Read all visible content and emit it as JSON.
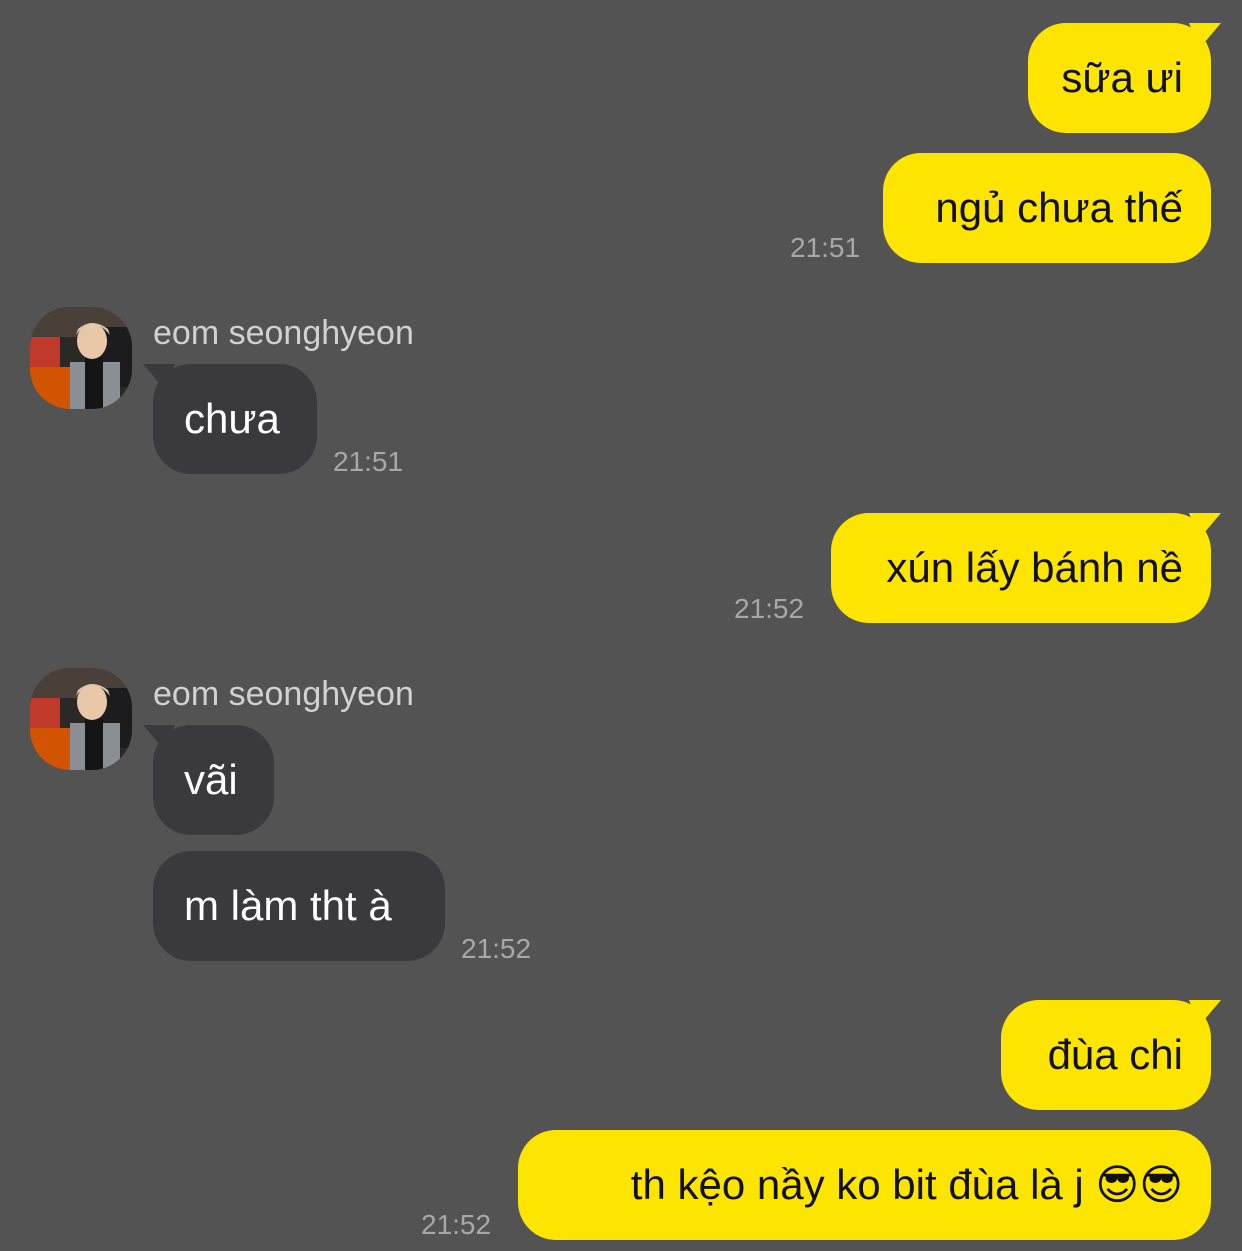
{
  "colors": {
    "background": "#545354",
    "sent_bubble": "#FEE500",
    "received_bubble": "#3A3A3C",
    "timestamp": "#A9A8A9"
  },
  "conversation": {
    "contact_name": "eom seonghyeon",
    "messages": [
      {
        "direction": "sent",
        "text": "sữa ưi"
      },
      {
        "direction": "sent",
        "text": "ngủ chưa thế",
        "time": "21:51"
      },
      {
        "direction": "received",
        "sender": "eom seonghyeon",
        "text": "chưa",
        "time": "21:51"
      },
      {
        "direction": "sent",
        "text": "xún lấy bánh nề",
        "time": "21:52"
      },
      {
        "direction": "received",
        "sender": "eom seonghyeon",
        "text": "vãi"
      },
      {
        "direction": "received",
        "text": "m làm tht à",
        "time": "21:52"
      },
      {
        "direction": "sent",
        "text": "đùa chi"
      },
      {
        "direction": "sent",
        "text": "th kệo nầy ko bit đùa là j 😎😎",
        "time": "21:52"
      }
    ]
  }
}
